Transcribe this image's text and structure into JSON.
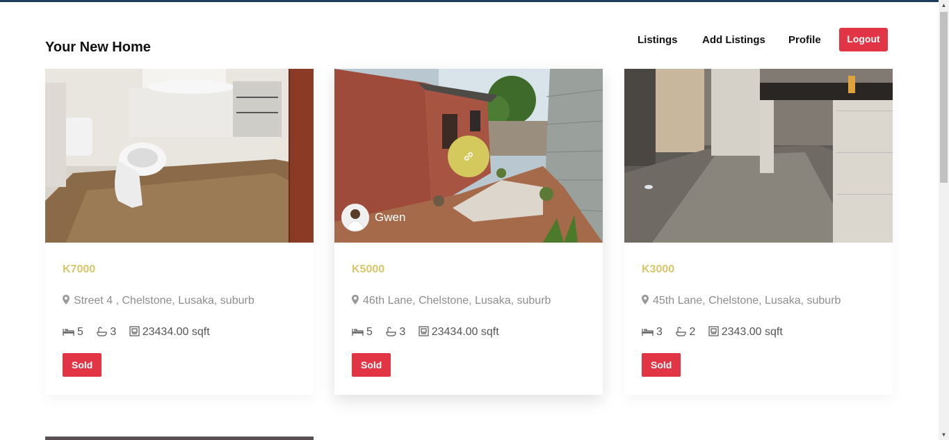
{
  "brand": {
    "title": "Your New Home"
  },
  "nav": {
    "listings": "Listings",
    "add_listings": "Add Listings",
    "profile": "Profile",
    "logout": "Logout"
  },
  "colors": {
    "accent_gold": "#d8c66a",
    "sold_red": "#e13546",
    "top_border": "#1b3a5c",
    "link_circle": "#d4c95c"
  },
  "listings": [
    {
      "price": "K7000",
      "address": "Street 4 , Chelstone, Lusaka, suburb",
      "beds": "5",
      "baths": "3",
      "area": "23434.00 sqft",
      "status": "Sold",
      "photo": "bathroom with toilet and bathtub"
    },
    {
      "price": "K5000",
      "address": "46th Lane, Chelstone, Lusaka, suburb",
      "beds": "5",
      "baths": "3",
      "area": "23434.00 sqft",
      "status": "Sold",
      "photo": "house exterior yard",
      "agent": "Gwen"
    },
    {
      "price": "K3000",
      "address": "45th Lane, Chelstone, Lusaka, suburb",
      "beds": "3",
      "baths": "2",
      "area": "2343.00 sqft",
      "status": "Sold",
      "photo": "kitchen interior"
    }
  ],
  "icons": [
    "map-pin-icon",
    "bed-icon",
    "bath-icon",
    "area-icon",
    "link-icon"
  ]
}
